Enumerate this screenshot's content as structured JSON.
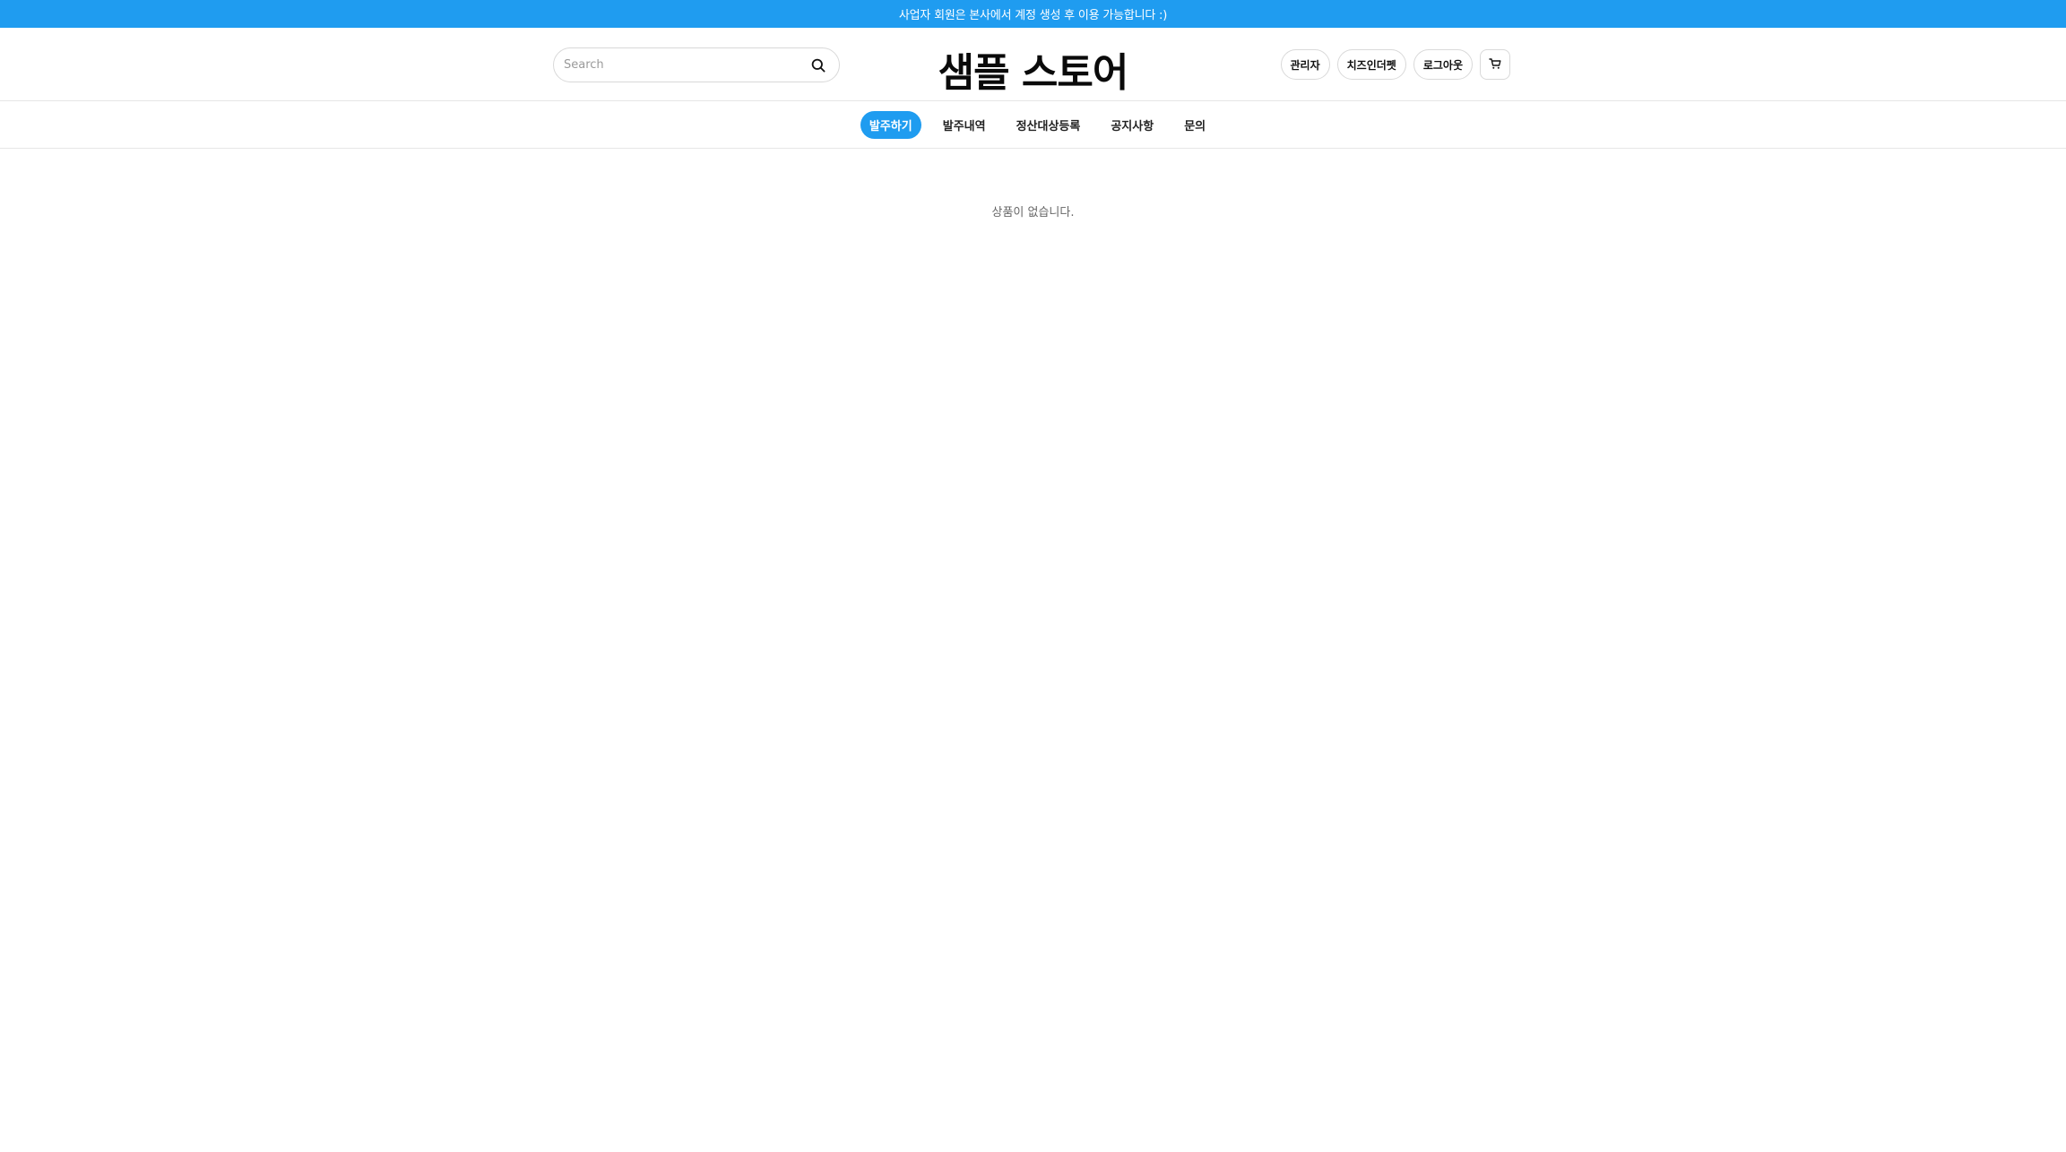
{
  "announcement": "사업자 회원은 본사에서 계정 생성 후 이용 가능합니다 :)",
  "search": {
    "placeholder": "Search",
    "icon": "search-icon"
  },
  "store_name": "샘플 스토어",
  "header_actions": {
    "admin_label": "관리자",
    "cheese_label": "치즈인더펫",
    "logout_label": "로그아웃",
    "cart_icon": "cart-icon"
  },
  "nav": {
    "items": [
      {
        "label": "발주하기",
        "active": true
      },
      {
        "label": "발주내역",
        "active": false
      },
      {
        "label": "정산대상등록",
        "active": false
      },
      {
        "label": "공지사항",
        "active": false
      },
      {
        "label": "문의",
        "active": false
      }
    ]
  },
  "main": {
    "empty_message": "상품이 없습니다."
  },
  "colors": {
    "accent": "#1f9cf0",
    "border": "#d9d9d9"
  }
}
